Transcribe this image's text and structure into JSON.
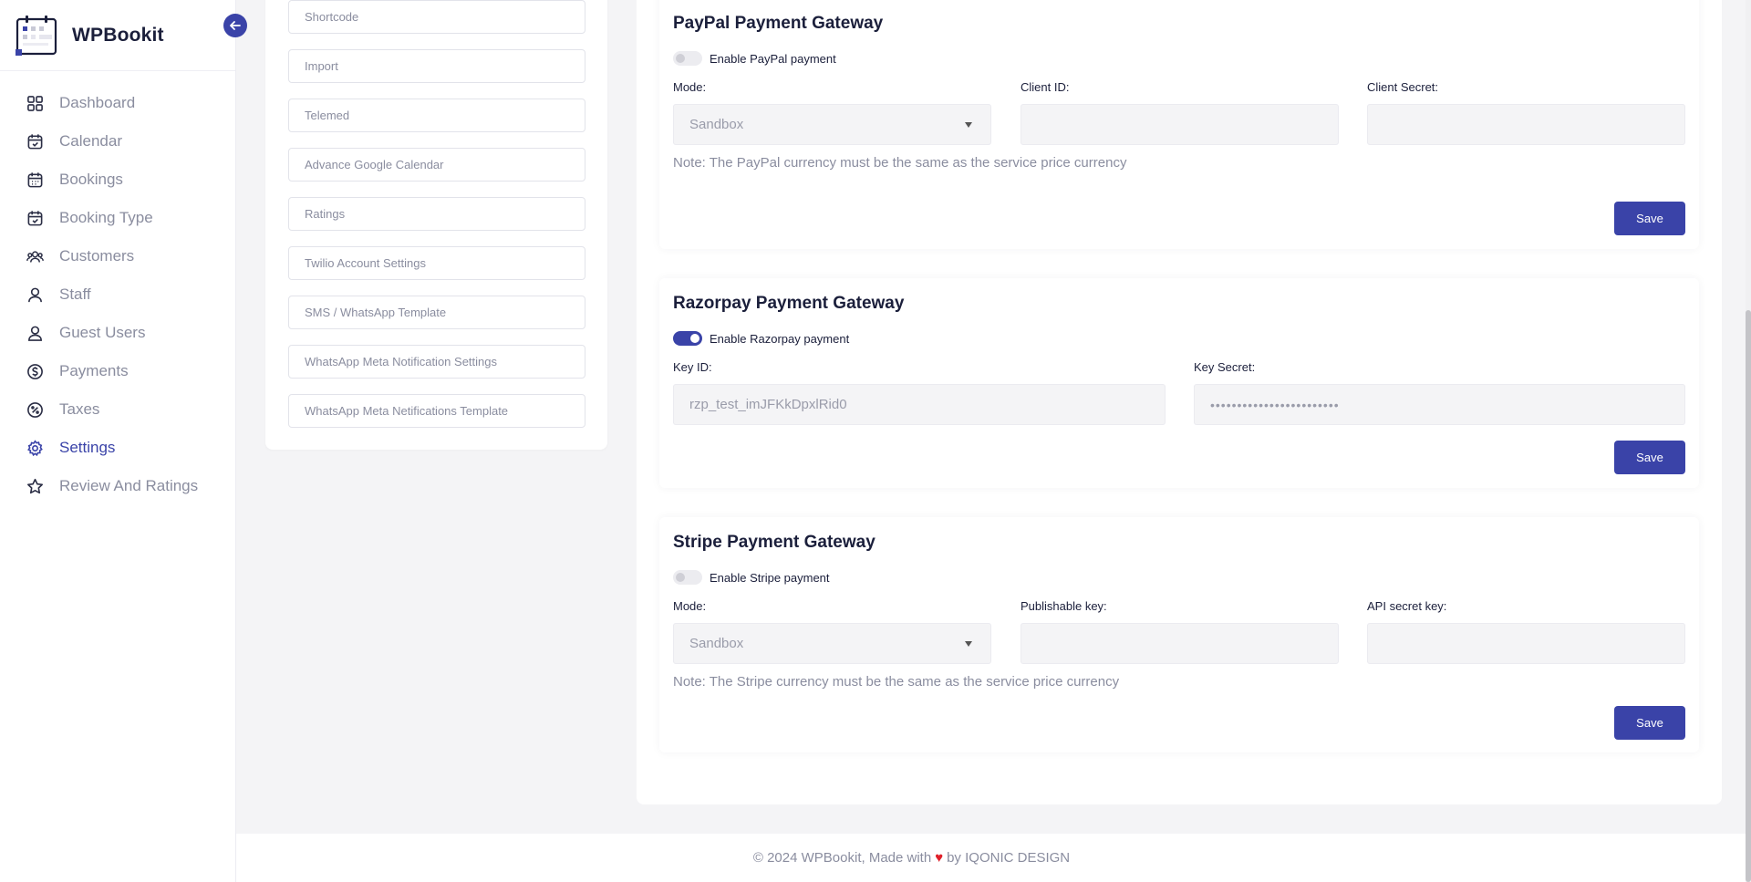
{
  "brand": {
    "name": "WPBookit"
  },
  "sidebar": {
    "items": [
      {
        "label": "Dashboard",
        "icon": "grid-icon"
      },
      {
        "label": "Calendar",
        "icon": "calendar-check-icon"
      },
      {
        "label": "Bookings",
        "icon": "calendar-grid-icon"
      },
      {
        "label": "Booking Type",
        "icon": "calendar-check-icon"
      },
      {
        "label": "Customers",
        "icon": "users-icon"
      },
      {
        "label": "Staff",
        "icon": "user-icon"
      },
      {
        "label": "Guest Users",
        "icon": "user-outline-icon"
      },
      {
        "label": "Payments",
        "icon": "dollar-circle-icon"
      },
      {
        "label": "Taxes",
        "icon": "percent-badge-icon"
      },
      {
        "label": "Settings",
        "icon": "gear-icon",
        "active": true
      },
      {
        "label": "Review And Ratings",
        "icon": "star-icon"
      }
    ]
  },
  "submenu": {
    "items": [
      "Shortcode",
      "Import",
      "Telemed",
      "Advance Google Calendar",
      "Ratings",
      "Twilio Account Settings",
      "SMS / WhatsApp Template",
      "WhatsApp Meta Notification Settings",
      "WhatsApp Meta Netifications Template"
    ]
  },
  "paypal": {
    "title": "PayPal Payment Gateway",
    "toggle_label": "Enable PayPal payment",
    "enabled": false,
    "mode_label": "Mode:",
    "mode_value": "Sandbox",
    "client_id_label": "Client ID:",
    "client_id_value": "",
    "client_secret_label": "Client Secret:",
    "client_secret_value": "",
    "note": "Note: The PayPal currency must be the same as the service price currency",
    "save_label": "Save"
  },
  "razorpay": {
    "title": "Razorpay Payment Gateway",
    "toggle_label": "Enable Razorpay payment",
    "enabled": true,
    "key_id_label": "Key ID:",
    "key_id_value": "rzp_test_imJFKkDpxlRid0",
    "key_secret_label": "Key Secret:",
    "key_secret_value": "••••••••••••••••••••••••",
    "save_label": "Save"
  },
  "stripe": {
    "title": "Stripe Payment Gateway",
    "toggle_label": "Enable Stripe payment",
    "enabled": false,
    "mode_label": "Mode:",
    "mode_value": "Sandbox",
    "publishable_key_label": "Publishable key:",
    "publishable_key_value": "",
    "api_secret_key_label": "API secret key:",
    "api_secret_key_value": "",
    "note": "Note: The Stripe currency must be the same as the service price currency",
    "save_label": "Save"
  },
  "footer": {
    "prefix": "© 2024 WPBookit, Made with",
    "heart": "♥",
    "suffix": "by IQONIC DESIGN"
  },
  "colors": {
    "accent": "#3a43a8",
    "heart": "#e0202a"
  }
}
